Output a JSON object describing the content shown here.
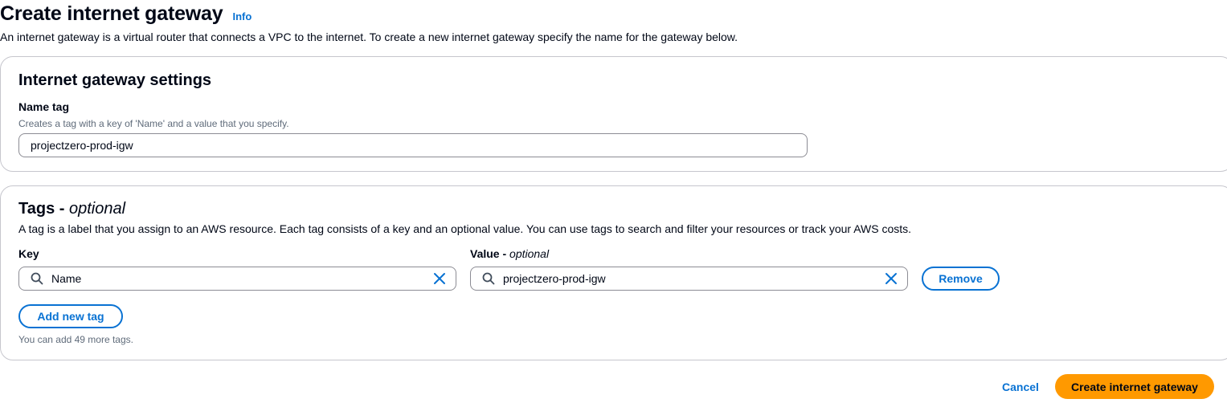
{
  "page": {
    "title": "Create internet gateway",
    "info_label": "Info",
    "description": "An internet gateway is a virtual router that connects a VPC to the internet. To create a new internet gateway specify the name for the gateway below."
  },
  "settings": {
    "heading": "Internet gateway settings",
    "name_tag": {
      "label": "Name tag",
      "hint": "Creates a tag with a key of 'Name' and a value that you specify.",
      "value": "projectzero-prod-igw"
    }
  },
  "tags": {
    "heading": "Tags - ",
    "heading_suffix": "optional",
    "description": "A tag is a label that you assign to an AWS resource. Each tag consists of a key and an optional value. You can use tags to search and filter your resources or track your AWS costs.",
    "key_label": "Key",
    "value_label": "Value - ",
    "value_label_suffix": "optional",
    "rows": [
      {
        "key": "Name",
        "value": "projectzero-prod-igw"
      }
    ],
    "remove_label": "Remove",
    "add_label": "Add new tag",
    "limit_hint": "You can add 49 more tags."
  },
  "footer": {
    "cancel_label": "Cancel",
    "submit_label": "Create internet gateway"
  },
  "icons": {
    "search": "search-icon",
    "clear": "close-icon"
  },
  "colors": {
    "link": "#0972d3",
    "primary": "#ff9900",
    "text": "#000716",
    "border": "#8c8c94"
  }
}
